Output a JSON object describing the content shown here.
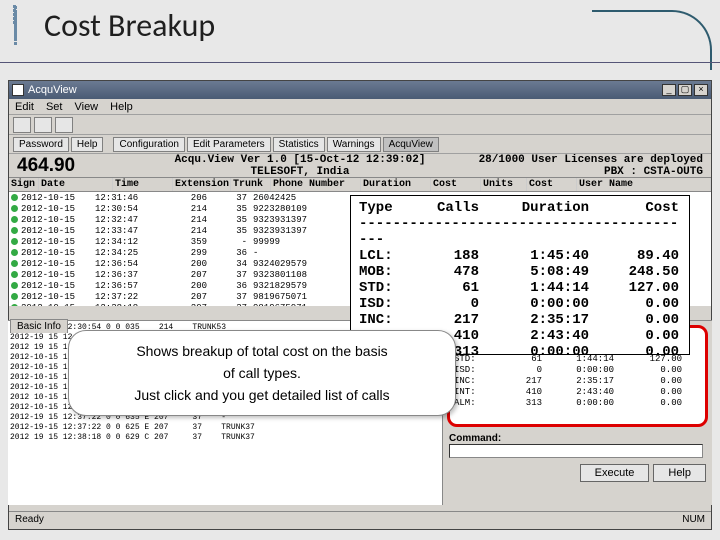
{
  "slide": {
    "title": "Cost Breakup"
  },
  "window": {
    "title": "AcquView",
    "menu": [
      "Edit",
      "Set",
      "View",
      "Help"
    ],
    "toolbar_tabs": [
      "Password",
      "Help",
      "Configuration",
      "Edit Parameters",
      "Statistics",
      "Warnings",
      "AcquView"
    ],
    "header": {
      "version": "Acqu.View Ver 1.0 [15-Oct-12 12:39:02]",
      "company": "TELESOFT, India",
      "licenses": "28/1000 User Licenses are deployed",
      "pbx": "PBX : CSTA-OUTG"
    },
    "total": "464.90",
    "columns": [
      "Sign",
      "Date",
      "Time",
      "Extension",
      "Trunk",
      "Phone Number",
      "Duration",
      "Cost",
      "Units",
      "Cost",
      "User Name"
    ],
    "rows": [
      {
        "date": "2012-10-15",
        "time": "12:31:46",
        "ext": "206",
        "trk": "37",
        "num": "26042425"
      },
      {
        "date": "2012-10-15",
        "time": "12:30:54",
        "ext": "214",
        "trk": "35",
        "num": "9223280109"
      },
      {
        "date": "2012-10-15",
        "time": "12:32:47",
        "ext": "214",
        "trk": "35",
        "num": "9323931397"
      },
      {
        "date": "2012-10-15",
        "time": "12:33:47",
        "ext": "214",
        "trk": "35",
        "num": "9323931397"
      },
      {
        "date": "2012-10-15",
        "time": "12:34:12",
        "ext": "359",
        "trk": "-",
        "num": "99999"
      },
      {
        "date": "2012-10-15",
        "time": "12:34:25",
        "ext": "299",
        "trk": "36",
        "num": "-"
      },
      {
        "date": "2012-10-15",
        "time": "12:36:54",
        "ext": "200",
        "trk": "34",
        "num": "9324029579"
      },
      {
        "date": "2012-10-15",
        "time": "12:36:37",
        "ext": "207",
        "trk": "37",
        "num": "9323801108"
      },
      {
        "date": "2012-10-15",
        "time": "12:36:57",
        "ext": "200",
        "trk": "36",
        "num": "9321829579"
      },
      {
        "date": "2012-10-15",
        "time": "12:37:22",
        "ext": "207",
        "trk": "37",
        "num": "9819675071"
      },
      {
        "date": "2012-10-15",
        "time": "12:38:18",
        "ext": "207",
        "trk": "37",
        "num": "9819675071"
      }
    ],
    "tab_basic": "Basic Info",
    "lower_rows": [
      "2012-10-15 12:30:54 0 0 035    214    TRUNK53",
      "2012-19 15 12:30:54 0 0 037    214    TRUNK57",
      "2012 19 15 12:30:54 0 0 037    214    TRUNK55",
      "2012-10-15 12:30:54 0 0 030 P 260     36    TRUNK56",
      "2012-10-15 12:36:54 0 0 034 P 200     34    TRUNK54",
      "2012-10-15 12:30:50 0 0 036 P 270     34    TRUNK95",
      "2012-10-15 12:35:35 D E 031 E 281     -     -",
      "2012 10-15 12:35:23 E E 031 E 215     -     -",
      "2012-10-15 12:37:22 0 0 610 C 207     37    TRUNK37",
      "2012-19 15 12:37:22 0 0 635 E 207     37    -",
      "2012-19-15 12:37:22 0 0 625 E 207     37    TRUNK37",
      "2012 19 15 12:38:18 0 0 629 C 207     37    TRUNK37"
    ],
    "command_label": "Command:",
    "buttons": {
      "execute": "Execute",
      "help": "Help"
    },
    "status": {
      "left": "Ready",
      "num": "NUM"
    }
  },
  "overlay": {
    "headers": [
      "Type",
      "Calls",
      "Duration",
      "Cost"
    ],
    "rows": [
      {
        "type": "LCL:",
        "calls": "188",
        "dur": "1:45:40",
        "cost": "89.40"
      },
      {
        "type": "MOB:",
        "calls": "478",
        "dur": "5:08:49",
        "cost": "248.50"
      },
      {
        "type": "STD:",
        "calls": "61",
        "dur": "1:44:14",
        "cost": "127.00"
      },
      {
        "type": "ISD:",
        "calls": "0",
        "dur": "0:00:00",
        "cost": "0.00"
      },
      {
        "type": "INC:",
        "calls": "217",
        "dur": "2:35:17",
        "cost": "0.00"
      },
      {
        "type": "INT:",
        "calls": "410",
        "dur": "2:43:40",
        "cost": "0.00"
      },
      {
        "type": "ALM:",
        "calls": "313",
        "dur": "0:00:00",
        "cost": "0.00"
      }
    ]
  },
  "summary": {
    "rows": [
      {
        "type": "LCL:",
        "calls": "188",
        "dur": "1:45:40",
        "cost": "89.40"
      },
      {
        "type": "MOB:",
        "calls": "478",
        "dur": "5:08:49",
        "cost": "248.50"
      },
      {
        "type": "STD:",
        "calls": "61",
        "dur": "1:44:14",
        "cost": "127.00"
      },
      {
        "type": "ISD:",
        "calls": "0",
        "dur": "0:00:00",
        "cost": "0.00"
      },
      {
        "type": "INC:",
        "calls": "217",
        "dur": "2:35:17",
        "cost": "0.00"
      },
      {
        "type": "INT:",
        "calls": "410",
        "dur": "2:43:40",
        "cost": "0.00"
      },
      {
        "type": "ALM:",
        "calls": "313",
        "dur": "0:00:00",
        "cost": "0.00"
      }
    ]
  },
  "callout": {
    "line1": "Shows breakup of total cost on the basis",
    "line2": "of call types.",
    "line3": "Just click and you get detailed list of calls"
  }
}
